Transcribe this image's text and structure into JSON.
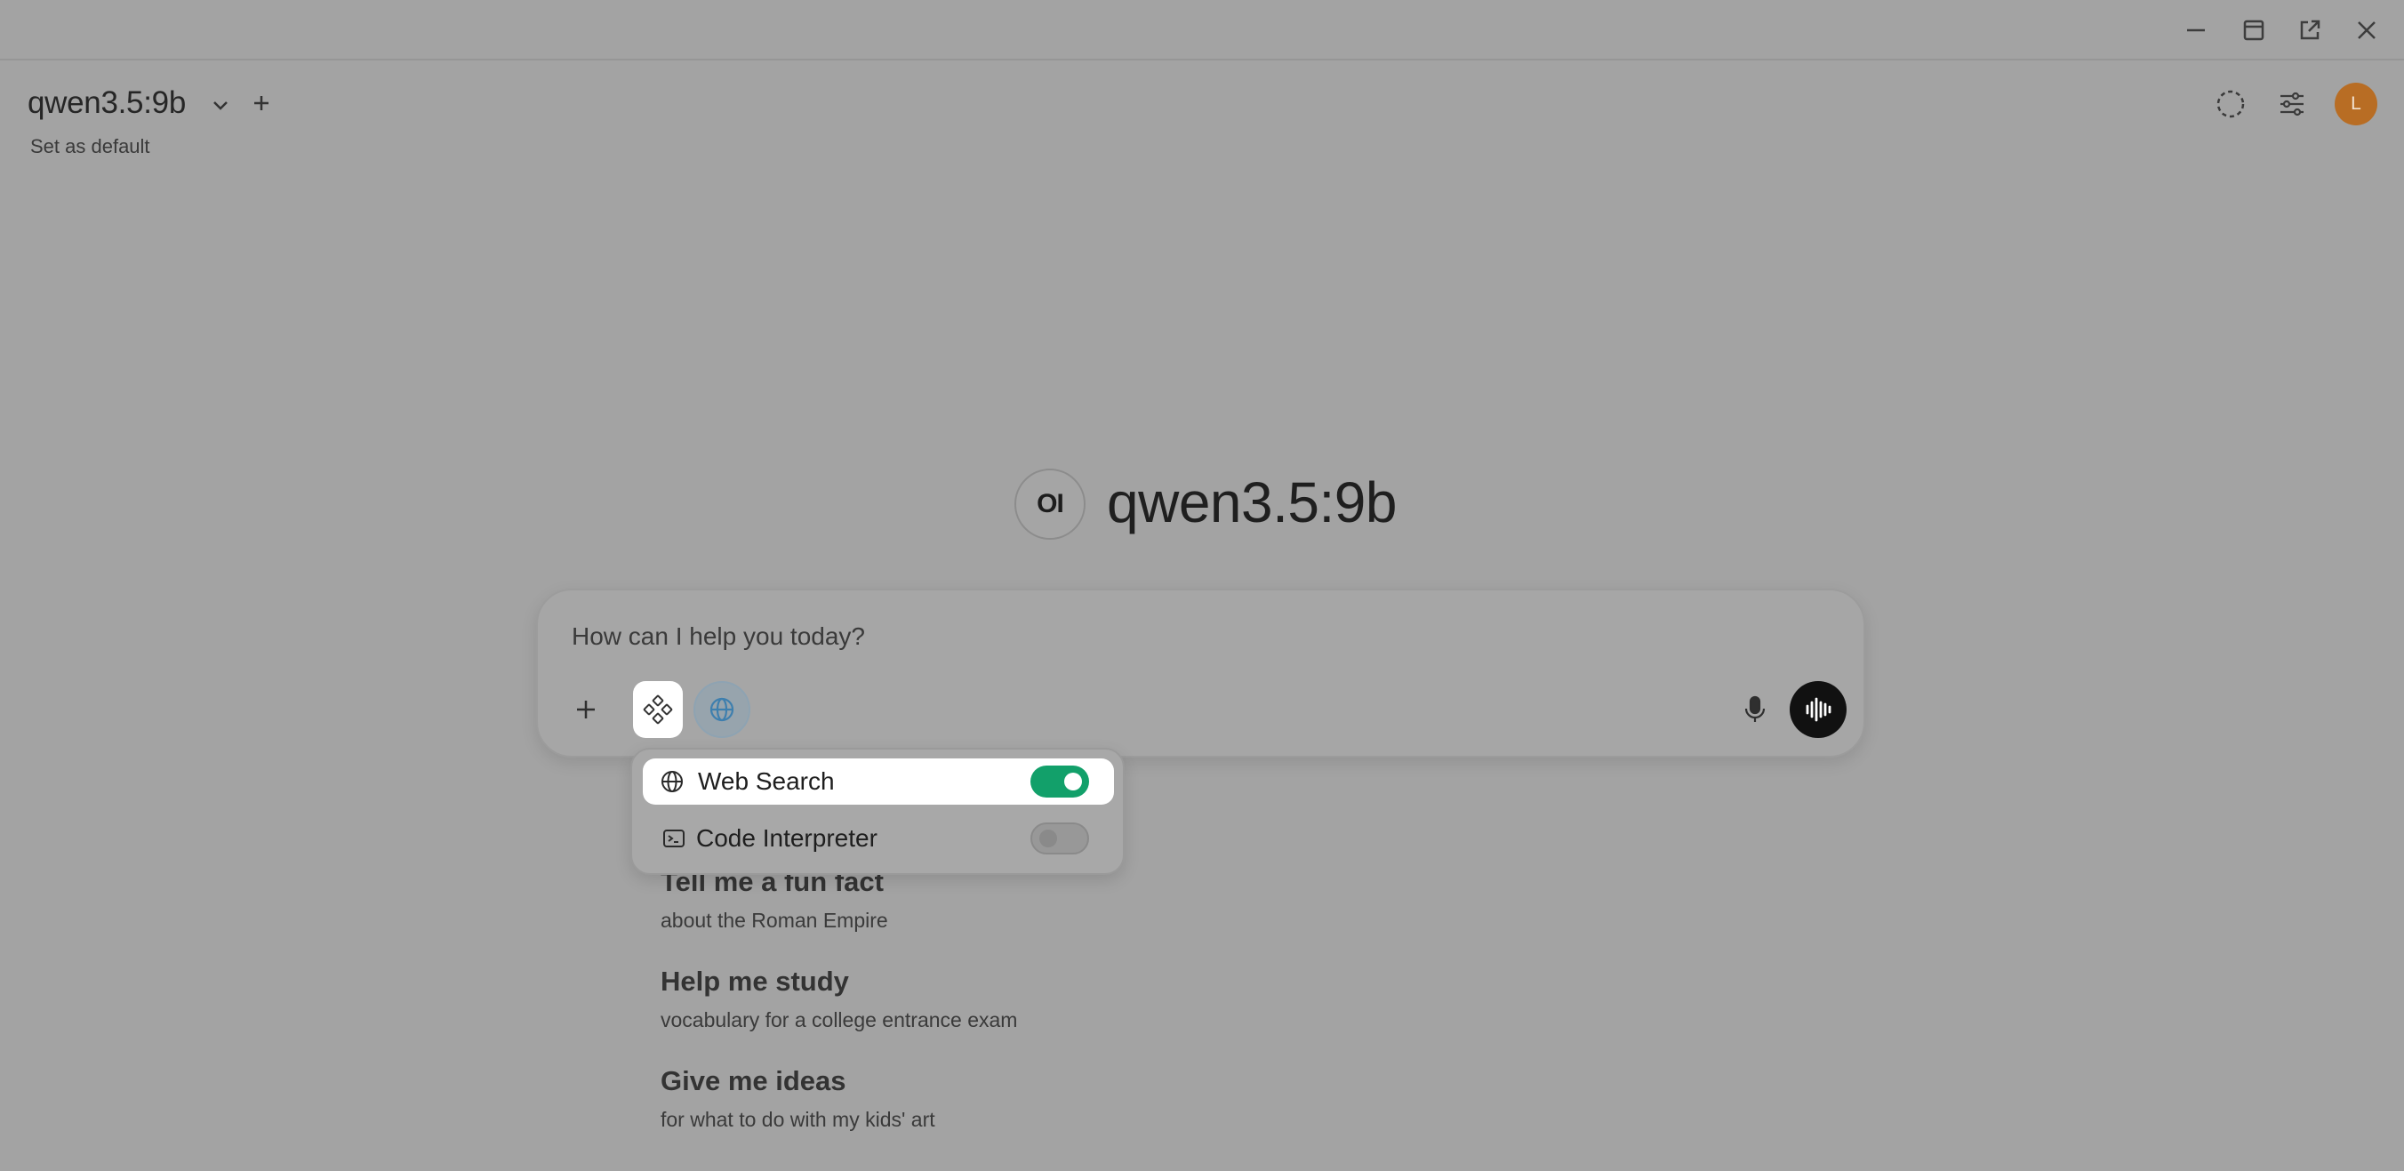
{
  "window": {
    "controls": [
      "minimize-icon",
      "restore-icon",
      "popout-icon",
      "close-icon"
    ]
  },
  "header": {
    "model_name": "qwen3.5:9b",
    "set_default": "Set as default",
    "avatar_initial": "L"
  },
  "center": {
    "logo_text": "OI",
    "title": "qwen3.5:9b"
  },
  "composer": {
    "placeholder": "How can I help you today?"
  },
  "tools_menu": {
    "items": [
      {
        "label": "Web Search",
        "icon": "globe-icon",
        "enabled": true
      },
      {
        "label": "Code Interpreter",
        "icon": "terminal-icon",
        "enabled": false
      }
    ]
  },
  "suggestions": [
    {
      "title": "Tell me a fun fact",
      "subtitle": "about the Roman Empire"
    },
    {
      "title": "Help me study",
      "subtitle": "vocabulary for a college entrance exam"
    },
    {
      "title": "Give me ideas",
      "subtitle": "for what to do with my kids' art"
    }
  ],
  "colors": {
    "background": "#a3a3a3",
    "toggle_on": "#12a06a",
    "avatar": "#b86d24"
  }
}
